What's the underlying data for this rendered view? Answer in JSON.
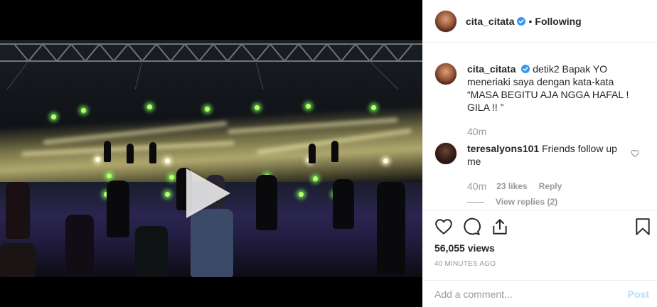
{
  "post": {
    "username": "cita_citata",
    "verified": true,
    "separator": "•",
    "follow_status": "Following"
  },
  "caption": {
    "username": "cita_citata",
    "text": "detik2 Bapak YO meneriaki saya dengan kata-kata “MASA BEGITU AJA NGGA HAFAL ! GILA !! ”",
    "age": "40m"
  },
  "comments": [
    {
      "username": "teresalyons101",
      "text": "Friends follow up me",
      "age": "40m",
      "likes": "23 likes",
      "reply_label": "Reply",
      "view_replies": "View replies (2)"
    }
  ],
  "stats": {
    "views": "56,055 views",
    "timestamp": "40 MINUTES AGO"
  },
  "composer": {
    "placeholder": "Add a comment...",
    "post_label": "Post"
  },
  "icons": {
    "verified": "verified-badge-icon",
    "like": "heart-icon",
    "comment": "comment-bubble-icon",
    "share": "share-icon",
    "save": "bookmark-icon",
    "play": "play-icon"
  },
  "colors": {
    "verified_blue": "#3897f0",
    "post_disabled": "#b2dffc",
    "muted_text": "#999999",
    "text": "#262626"
  }
}
